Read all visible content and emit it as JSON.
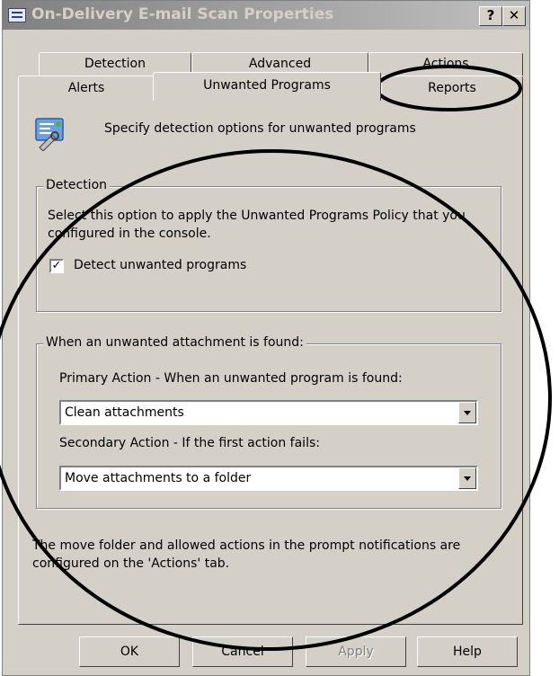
{
  "window": {
    "title": "On-Delivery E-mail Scan Properties",
    "help_button": "?",
    "close_button": "✕"
  },
  "tabs": {
    "row1": [
      "Detection",
      "Advanced",
      "Actions"
    ],
    "row2": [
      "Alerts",
      "Unwanted Programs",
      "Reports"
    ],
    "selected": "Unwanted Programs"
  },
  "panel": {
    "header_icon": "settings-wrench-icon",
    "header_text": "Specify detection options for unwanted programs",
    "detection_group": {
      "legend": "Detection",
      "description": "Select this option to apply the Unwanted Programs Policy that you configured in the console.",
      "checkbox_label": "Detect unwanted programs",
      "checkbox_checked": true
    },
    "attachment_group": {
      "legend": "When an unwanted attachment is found:",
      "primary_label": "Primary Action - When an unwanted program is found:",
      "primary_value": "Clean attachments",
      "secondary_label": "Secondary Action - If the first action fails:",
      "secondary_value": "Move attachments to a folder"
    },
    "footer_note": "The move folder and allowed actions in the prompt notifications are configured on the 'Actions' tab."
  },
  "buttons": {
    "ok": "OK",
    "cancel": "Cancel",
    "apply": "Apply",
    "help": "Help"
  },
  "colors": {
    "dialog_face": "#d4d0c8",
    "annotation_ink": "#000000"
  }
}
